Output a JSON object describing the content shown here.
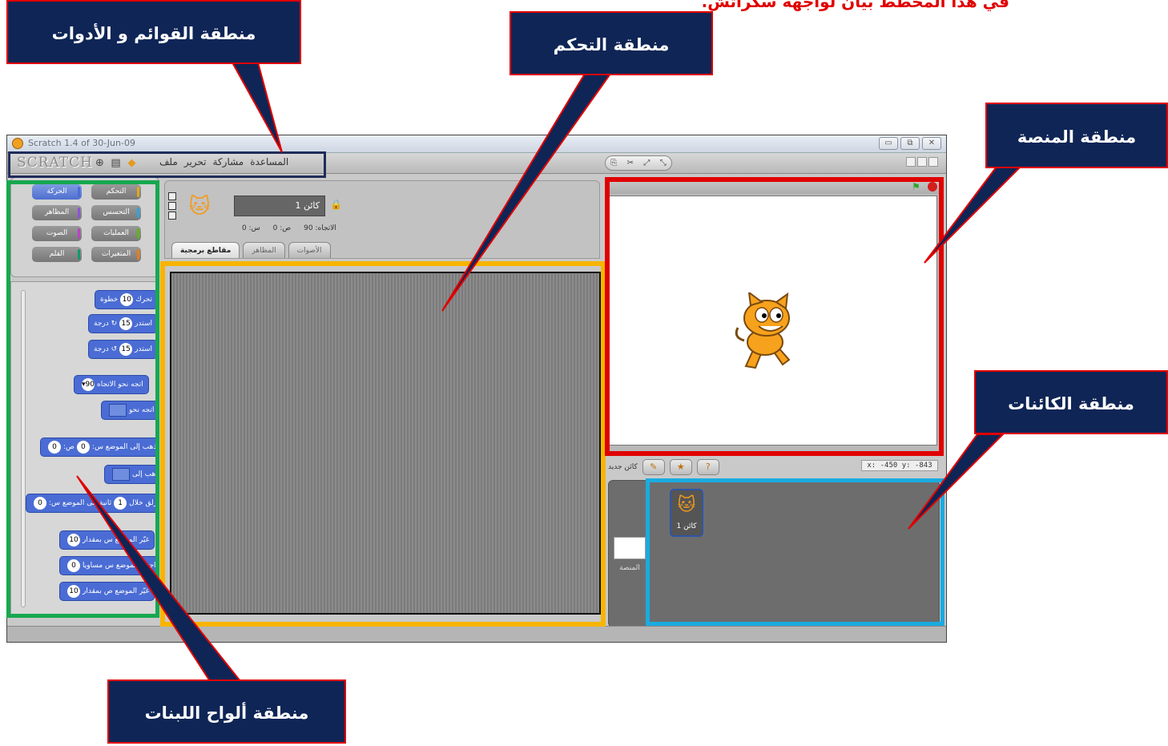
{
  "header": {
    "note": "في هذا المخطط بيان لواجهة سكراتش."
  },
  "window": {
    "title": "Scratch 1.4 of 30-Jun-09",
    "controls": [
      "▭",
      "⧉",
      "✕"
    ]
  },
  "menubar": {
    "logo": "SCRATCH",
    "menus": [
      "ملف",
      "تحرير",
      "مشاركة",
      "المساعدة"
    ]
  },
  "palette": {
    "categories": [
      {
        "label": "الحركة",
        "color": "#4a6cd4",
        "selected": true
      },
      {
        "label": "التحكم",
        "color": "#e1a91a",
        "selected": false
      },
      {
        "label": "المظاهر",
        "color": "#8a55d7",
        "selected": false
      },
      {
        "label": "التحسس",
        "color": "#2ca5e2",
        "selected": false
      },
      {
        "label": "الصوت",
        "color": "#bb42c3",
        "selected": false
      },
      {
        "label": "العمليات",
        "color": "#5cb712",
        "selected": false
      },
      {
        "label": "القلم",
        "color": "#0e9a6c",
        "selected": false
      },
      {
        "label": "المتغيرات",
        "color": "#ee7d16",
        "selected": false
      }
    ],
    "blocks": [
      {
        "label": "تحرك",
        "slot": "10",
        "suffix": "خطوة"
      },
      {
        "label": "استدر",
        "slot": "15",
        "suffix": "↻ درجة"
      },
      {
        "label": "استدر",
        "slot": "15",
        "suffix": "↺ درجة"
      },
      {
        "label": "اتجه نحو الاتجاه",
        "slot": "90▾",
        "suffix": ""
      },
      {
        "label": "اتجه نحو",
        "slot": "",
        "suffix": ""
      },
      {
        "label": "اذهب إلى الموضع س:",
        "slot": "0",
        "suffix": "ص:",
        "slot2": "0"
      },
      {
        "label": "اذهب إلى",
        "slot": "",
        "suffix": ""
      },
      {
        "label": "انزلق خلال",
        "slot": "1",
        "suffix": "ثانية إلى الموضع س:",
        "slot2": "0"
      },
      {
        "label": "غيّر الموضع س بمقدار",
        "slot": "10",
        "suffix": ""
      },
      {
        "label": "اجعل الموضع س مساويا",
        "slot": "0",
        "suffix": ""
      },
      {
        "label": "غيّر الموضع ص بمقدار",
        "slot": "10",
        "suffix": ""
      }
    ]
  },
  "sprite_info": {
    "name": "كائن 1",
    "x": "0",
    "y": "0",
    "direction": "90",
    "x_label": "س:",
    "y_label": "ص:",
    "direction_label": "الاتجاه:"
  },
  "tabs": [
    "مقاطع برمجية",
    "المظاهر",
    "الأصوات"
  ],
  "stage": {
    "mouse_readout": "x: -450  y: -843"
  },
  "sprite_corral": {
    "new_sprite_label": "كائن جديد",
    "stage_label": "المنصة",
    "sprite_label": "كائن 1"
  },
  "callouts": {
    "menus": "منطقة القوائم و الأدوات",
    "control": "منطقة التحكم",
    "stage": "منطقة المنصة",
    "sprites": "منطقة الكائنات",
    "palette": "منطقة ألواح اللبنات"
  },
  "colors": {
    "menus_highlight": "#1f2c5a",
    "palette_highlight": "#17a84f",
    "scripts_highlight": "#f7b500",
    "stage_highlight": "#e00000",
    "sprites_highlight": "#1aabe0",
    "callout_bg": "#0f2556",
    "callout_border": "#e00000"
  }
}
